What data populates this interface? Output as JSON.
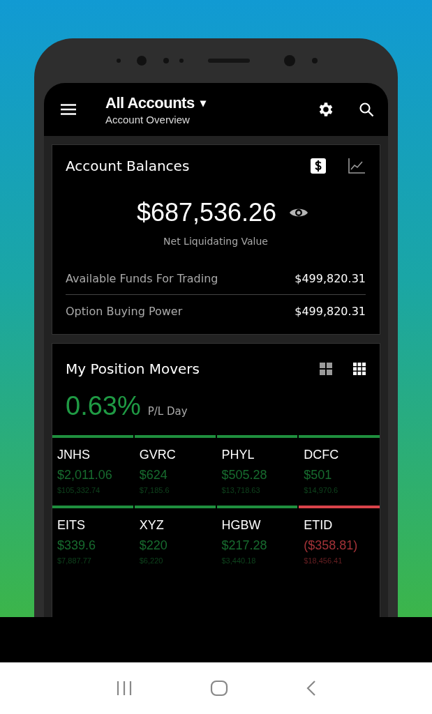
{
  "app_bar": {
    "title": "All Accounts",
    "caret": "▾",
    "subtitle": "Account Overview"
  },
  "balances": {
    "title": "Account Balances",
    "view_toggles": [
      {
        "kind": "dollar",
        "selected": true
      },
      {
        "kind": "chart",
        "selected": false
      }
    ],
    "net_value": "$687,536.26",
    "net_label": "Net Liquidating Value",
    "rows": [
      {
        "label": "Available Funds For Trading",
        "value": "$499,820.31"
      },
      {
        "label": "Option Buying Power",
        "value": "$499,820.31"
      }
    ]
  },
  "movers": {
    "title": "My Position Movers",
    "view_toggles": [
      {
        "kind": "grid4",
        "selected": false
      },
      {
        "kind": "grid9",
        "selected": true
      }
    ],
    "percent": "0.63%",
    "percent_label": "P/L Day",
    "tiles": [
      {
        "symbol": "JNHS",
        "pl": "$2,011.06",
        "value": "$105,332.74",
        "color": "#1f8f3e"
      },
      {
        "symbol": "GVRC",
        "pl": "$624",
        "value": "$7,185.6",
        "color": "#1f8f3e"
      },
      {
        "symbol": "PHYL",
        "pl": "$505.28",
        "value": "$13,718.63",
        "color": "#1f8f3e"
      },
      {
        "symbol": "DCFC",
        "pl": "$501",
        "value": "$14,970.6",
        "color": "#1f8f3e"
      },
      {
        "symbol": "EITS",
        "pl": "$339.6",
        "value": "$7,887.77",
        "color": "#1f8f3e"
      },
      {
        "symbol": "XYZ",
        "pl": "$220",
        "value": "$6,220",
        "color": "#1f8f3e"
      },
      {
        "symbol": "HGBW",
        "pl": "$217.28",
        "value": "$3,440.18",
        "color": "#1f8f3e"
      },
      {
        "symbol": "ETID",
        "pl": "($358.81)",
        "value": "$18,456.41",
        "color": "#d9434a"
      }
    ]
  }
}
